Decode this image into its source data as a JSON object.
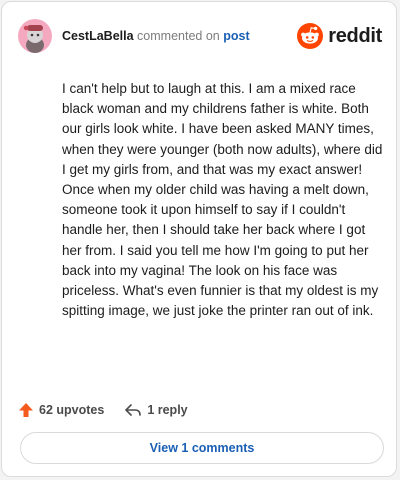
{
  "header": {
    "username": "CestLaBella",
    "action_text": "commented on",
    "post_link": "post",
    "brand_name": "reddit"
  },
  "comment": {
    "paragraphs": [
      "I can't help but to laugh at this. I am a mixed race black woman and my childrens father is white. Both our girls look white. I have been asked MANY times, when they were younger (both now adults), where did I get my girls from, and that was my exact answer!",
      "Once when my older child was having a melt down, someone took it upon himself to say if I couldn't handle her, then I should take her back where I got her from. I said you tell me how I'm going to put her back into my vagina! The look on his face was priceless. What's even funnier is that my oldest is my spitting image, we just joke the printer ran out of ink."
    ]
  },
  "actions": {
    "upvotes_label": "62 upvotes",
    "reply_label": "1 reply"
  },
  "view_comments_label": "View 1 comments",
  "colors": {
    "brand_orange": "#ff4500",
    "link_blue": "#1a5fb4",
    "avatar_pink": "#f4a9c1",
    "upvote_orange": "#f55a1e"
  },
  "icons": {
    "avatar": "snoo-avatar-icon",
    "brand": "reddit-logo-icon",
    "upvote": "upvote-arrow-icon",
    "reply": "reply-arrow-icon"
  }
}
